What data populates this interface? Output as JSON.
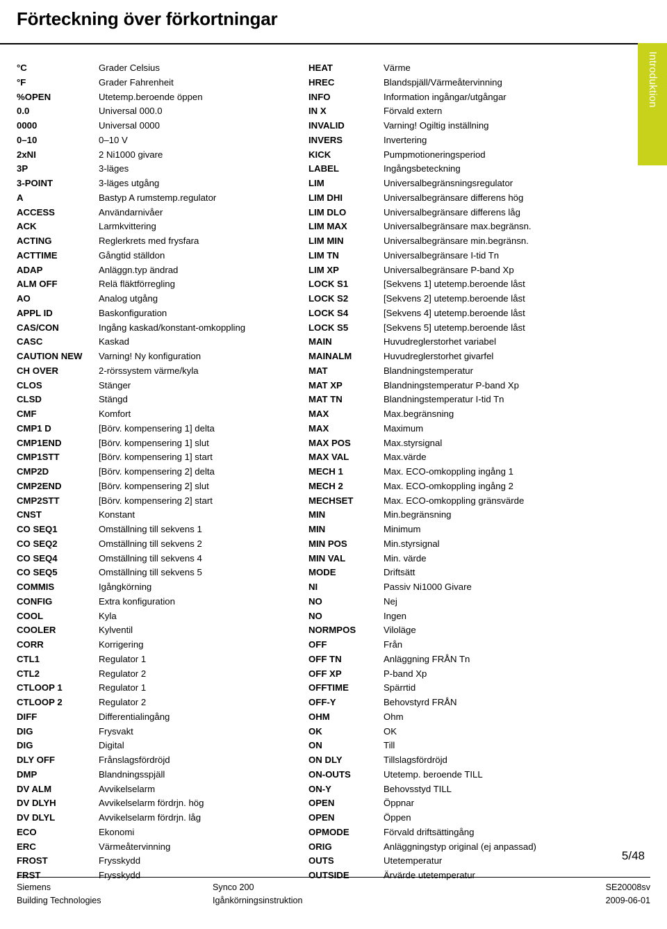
{
  "document": {
    "title": "Förteckning över förkortningar",
    "side_tab_label": "Introduktion",
    "page_number": "5/48"
  },
  "left_column": [
    {
      "abbr": "°C",
      "desc": "Grader Celsius"
    },
    {
      "abbr": "°F",
      "desc": "Grader Fahrenheit"
    },
    {
      "abbr": "%OPEN",
      "desc": "Utetemp.beroende öppen"
    },
    {
      "abbr": "0.0",
      "desc": "Universal 000.0"
    },
    {
      "abbr": "0000",
      "desc": "Universal 0000"
    },
    {
      "abbr": "0–10",
      "desc": "0–10 V"
    },
    {
      "abbr": "2xNI",
      "desc": "2 Ni1000 givare"
    },
    {
      "abbr": "3P",
      "desc": "3-läges"
    },
    {
      "abbr": "3-POINT",
      "desc": "3-läges utgång"
    },
    {
      "abbr": "A",
      "desc": "Bastyp A rumstemp.regulator"
    },
    {
      "abbr": "ACCESS",
      "desc": "Användarnivåer"
    },
    {
      "abbr": "ACK",
      "desc": "Larmkvittering"
    },
    {
      "abbr": "ACTING",
      "desc": "Reglerkrets med frysfara"
    },
    {
      "abbr": "ACTTIME",
      "desc": "Gångtid ställdon"
    },
    {
      "abbr": "ADAP",
      "desc": "Anläggn.typ ändrad"
    },
    {
      "abbr": "ALM OFF",
      "desc": "Relä fläktförregling"
    },
    {
      "abbr": "AO",
      "desc": "Analog utgång"
    },
    {
      "abbr": "APPL ID",
      "desc": "Baskonfiguration"
    },
    {
      "abbr": "CAS/CON",
      "desc": "Ingång kaskad/konstant-omkoppling"
    },
    {
      "abbr": "CASC",
      "desc": "Kaskad"
    },
    {
      "abbr": "CAUTION NEW",
      "desc": "Varning! Ny konfiguration"
    },
    {
      "abbr": "CH OVER",
      "desc": "2-rörssystem värme/kyla"
    },
    {
      "abbr": "CLOS",
      "desc": "Stänger"
    },
    {
      "abbr": "CLSD",
      "desc": "Stängd"
    },
    {
      "abbr": "CMF",
      "desc": "Komfort"
    },
    {
      "abbr": "CMP1 D",
      "desc": "[Börv. kompensering 1] delta"
    },
    {
      "abbr": "CMP1END",
      "desc": "[Börv. kompensering 1] slut"
    },
    {
      "abbr": "CMP1STT",
      "desc": "[Börv. kompensering 1] start"
    },
    {
      "abbr": "CMP2D",
      "desc": "[Börv. kompensering 2] delta"
    },
    {
      "abbr": "CMP2END",
      "desc": "[Börv. kompensering 2] slut"
    },
    {
      "abbr": "CMP2STT",
      "desc": "[Börv. kompensering 2] start"
    },
    {
      "abbr": "CNST",
      "desc": "Konstant"
    },
    {
      "abbr": "CO SEQ1",
      "desc": "Omställning till sekvens 1"
    },
    {
      "abbr": "CO SEQ2",
      "desc": "Omställning till sekvens 2"
    },
    {
      "abbr": "CO SEQ4",
      "desc": "Omställning till sekvens 4"
    },
    {
      "abbr": "CO SEQ5",
      "desc": "Omställning till sekvens 5"
    },
    {
      "abbr": "COMMIS",
      "desc": "Igångkörning"
    },
    {
      "abbr": "CONFIG",
      "desc": "Extra konfiguration"
    },
    {
      "abbr": "COOL",
      "desc": "Kyla"
    },
    {
      "abbr": "COOLER",
      "desc": "Kylventil"
    },
    {
      "abbr": "CORR",
      "desc": "Korrigering"
    },
    {
      "abbr": "CTL1",
      "desc": "Regulator 1"
    },
    {
      "abbr": "CTL2",
      "desc": "Regulator 2"
    },
    {
      "abbr": "CTLOOP 1",
      "desc": "Regulator 1"
    },
    {
      "abbr": "CTLOOP 2",
      "desc": "Regulator 2"
    },
    {
      "abbr": "DIFF",
      "desc": "Differentialingång"
    },
    {
      "abbr": "DIG",
      "desc": "Frysvakt"
    },
    {
      "abbr": "DIG",
      "desc": "Digital"
    },
    {
      "abbr": "DLY OFF",
      "desc": "Frånslagsfördröjd"
    },
    {
      "abbr": "DMP",
      "desc": "Blandningsspjäll"
    },
    {
      "abbr": "DV ALM",
      "desc": "Avvikelselarm"
    },
    {
      "abbr": "DV DLYH",
      "desc": "Avvikelselarm fördrjn. hög"
    },
    {
      "abbr": "DV DLYL",
      "desc": "Avvikelselarm fördrjn. låg"
    },
    {
      "abbr": "ECO",
      "desc": "Ekonomi"
    },
    {
      "abbr": "ERC",
      "desc": "Värmeåtervinning"
    },
    {
      "abbr": "FROST",
      "desc": "Frysskydd"
    },
    {
      "abbr": "FRST",
      "desc": "Frysskydd"
    }
  ],
  "right_column": [
    {
      "abbr": "HEAT",
      "desc": "Värme"
    },
    {
      "abbr": "HREC",
      "desc": "Blandspjäll/Värmeåtervinning"
    },
    {
      "abbr": "INFO",
      "desc": "Information ingångar/utgångar"
    },
    {
      "abbr": "IN X",
      "desc": "Förvald extern"
    },
    {
      "abbr": "INVALID",
      "desc": "Varning! Ogiltig inställning"
    },
    {
      "abbr": "INVERS",
      "desc": "Invertering"
    },
    {
      "abbr": "KICK",
      "desc": "Pumpmotioneringsperiod"
    },
    {
      "abbr": "LABEL",
      "desc": "Ingångsbeteckning"
    },
    {
      "abbr": "LIM",
      "desc": "Universalbegränsningsregulator"
    },
    {
      "abbr": "LIM DHI",
      "desc": "Universalbegränsare differens hög"
    },
    {
      "abbr": "LIM DLO",
      "desc": "Universalbegränsare differens låg"
    },
    {
      "abbr": "LIM MAX",
      "desc": "Universalbegränsare max.begränsn."
    },
    {
      "abbr": "LIM MIN",
      "desc": "Universalbegränsare min.begränsn."
    },
    {
      "abbr": "LIM TN",
      "desc": "Universalbegränsare I-tid Tn"
    },
    {
      "abbr": "LIM XP",
      "desc": "Universalbegränsare P-band Xp"
    },
    {
      "abbr": "LOCK S1",
      "desc": "[Sekvens 1] utetemp.beroende låst"
    },
    {
      "abbr": "LOCK S2",
      "desc": "[Sekvens 2] utetemp.beroende låst"
    },
    {
      "abbr": "LOCK S4",
      "desc": "[Sekvens 4] utetemp.beroende låst"
    },
    {
      "abbr": "LOCK S5",
      "desc": "[Sekvens 5] utetemp.beroende låst"
    },
    {
      "abbr": "MAIN",
      "desc": "Huvudreglerstorhet variabel"
    },
    {
      "abbr": "MAINALM",
      "desc": "Huvudreglerstorhet givarfel"
    },
    {
      "abbr": "MAT",
      "desc": "Blandningstemperatur"
    },
    {
      "abbr": "MAT XP",
      "desc": "Blandningstemperatur P-band Xp"
    },
    {
      "abbr": "MAT TN",
      "desc": "Blandningstemperatur I-tid Tn"
    },
    {
      "abbr": "MAX",
      "desc": "Max.begränsning"
    },
    {
      "abbr": "MAX",
      "desc": "Maximum"
    },
    {
      "abbr": "MAX POS",
      "desc": "Max.styrsignal"
    },
    {
      "abbr": "MAX VAL",
      "desc": "Max.värde"
    },
    {
      "abbr": "MECH 1",
      "desc": "Max. ECO-omkoppling ingång 1"
    },
    {
      "abbr": "MECH 2",
      "desc": "Max. ECO-omkoppling ingång 2"
    },
    {
      "abbr": "MECHSET",
      "desc": "Max. ECO-omkoppling gränsvärde"
    },
    {
      "abbr": "MIN",
      "desc": "Min.begränsning"
    },
    {
      "abbr": "MIN",
      "desc": "Minimum"
    },
    {
      "abbr": "MIN POS",
      "desc": "Min.styrsignal"
    },
    {
      "abbr": "MIN VAL",
      "desc": "Min. värde"
    },
    {
      "abbr": "MODE",
      "desc": "Driftsätt"
    },
    {
      "abbr": "NI",
      "desc": "Passiv Ni1000 Givare"
    },
    {
      "abbr": "NO",
      "desc": "Nej"
    },
    {
      "abbr": "NO",
      "desc": "Ingen"
    },
    {
      "abbr": "NORMPOS",
      "desc": "Viloläge"
    },
    {
      "abbr": "OFF",
      "desc": "Från"
    },
    {
      "abbr": "OFF TN",
      "desc": "Anläggning FRÅN Tn"
    },
    {
      "abbr": "OFF XP",
      "desc": "P-band Xp"
    },
    {
      "abbr": "OFFTIME",
      "desc": "Spärrtid"
    },
    {
      "abbr": "OFF-Y",
      "desc": "Behovstyrd FRÅN"
    },
    {
      "abbr": "OHM",
      "desc": "Ohm"
    },
    {
      "abbr": "OK",
      "desc": "OK"
    },
    {
      "abbr": "ON",
      "desc": "Till"
    },
    {
      "abbr": "ON DLY",
      "desc": "Tillslagsfördröjd"
    },
    {
      "abbr": "ON-OUTS",
      "desc": "Utetemp. beroende TILL"
    },
    {
      "abbr": "ON-Y",
      "desc": "Behovsstyd TILL"
    },
    {
      "abbr": "OPEN",
      "desc": "Öppnar"
    },
    {
      "abbr": "OPEN",
      "desc": "Öppen"
    },
    {
      "abbr": "OPMODE",
      "desc": "Förvald driftsättingång"
    },
    {
      "abbr": "ORIG",
      "desc": "Anläggningstyp original (ej anpassad)"
    },
    {
      "abbr": "OUTS",
      "desc": "Utetemperatur"
    },
    {
      "abbr": "OUTSIDE",
      "desc": "Ärvärde utetemperatur"
    }
  ],
  "footer": {
    "line1_col1": "Siemens",
    "line1_col2": "Synco 200",
    "line1_col3": "SE20008sv",
    "line2_col1": "Building Technologies",
    "line2_col2": "Igånkörningsinstruktion",
    "line2_col3": "2009-06-01"
  }
}
